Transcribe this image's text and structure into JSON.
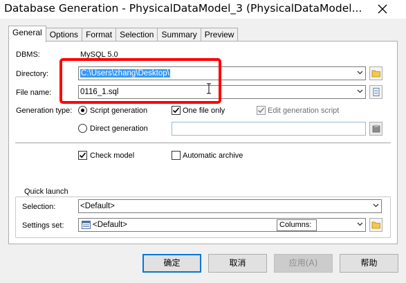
{
  "window": {
    "title": "Database Generation - PhysicalDataModel_3 (PhysicalDataModel..."
  },
  "tabs": [
    {
      "label": "General",
      "active": true
    },
    {
      "label": "Options",
      "active": false
    },
    {
      "label": "Format",
      "active": false
    },
    {
      "label": "Selection",
      "active": false
    },
    {
      "label": "Summary",
      "active": false
    },
    {
      "label": "Preview",
      "active": false
    }
  ],
  "general": {
    "dbms_label": "DBMS:",
    "dbms_value": "MySQL 5.0",
    "directory_label": "Directory:",
    "directory_value": "C:\\Users\\zhang\\Desktop\\",
    "filename_label": "File name:",
    "filename_value": "0116_1.sql",
    "generation_type_label": "Generation type:",
    "script_generation": {
      "label": "Script generation",
      "selected": true
    },
    "direct_generation": {
      "label": "Direct generation",
      "selected": false
    },
    "one_file_only": {
      "label": "One file only",
      "checked": true
    },
    "edit_generation_script": {
      "label": "Edit generation script",
      "checked": true,
      "disabled": true
    },
    "direct_source_value": "",
    "check_model": {
      "label": "Check model",
      "checked": true
    },
    "automatic_archive": {
      "label": "Automatic archive",
      "checked": false
    }
  },
  "quick_launch": {
    "title": "Quick launch",
    "selection_label": "Selection:",
    "selection_value": "<Default>",
    "settings_label": "Settings set:",
    "settings_value": "<Default>",
    "columns_label": "Columns:"
  },
  "buttons": {
    "ok": "确定",
    "cancel": "取消",
    "apply": "应用(A)",
    "help": "帮助"
  },
  "colors": {
    "highlight": "#ff0000",
    "selection": "#3399ff",
    "default_button_border": "#0078d7"
  }
}
